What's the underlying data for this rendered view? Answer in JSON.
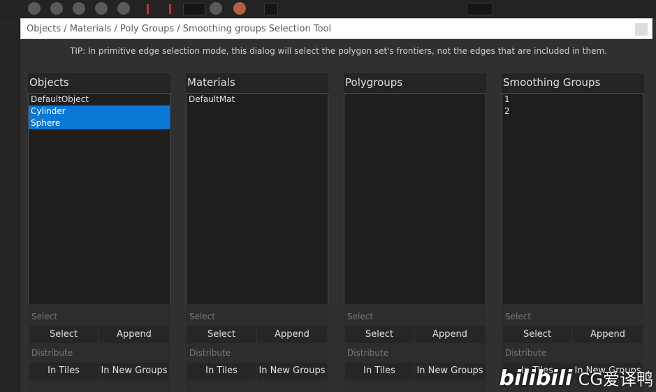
{
  "dialog": {
    "breadcrumb": "Objects / Materials / Poly Groups / Smoothing groups Selection Tool",
    "tip": "TIP: In primitive edge selection mode, this dialog will select the polygon set's frontiers, not the edges that are included in them."
  },
  "panels": [
    {
      "title": "Objects",
      "items": [
        {
          "label": "DefaultObject",
          "selected": false
        },
        {
          "label": "Cylinder",
          "selected": true
        },
        {
          "label": "Sphere",
          "selected": true
        }
      ],
      "select_label": "Select",
      "select_button": "Select",
      "append_button": "Append",
      "distribute_label": "Distribute",
      "in_tiles_button": "In Tiles",
      "in_new_groups_button": "In New Groups"
    },
    {
      "title": "Materials",
      "items": [
        {
          "label": "DefaultMat",
          "selected": false
        }
      ],
      "select_label": "Select",
      "select_button": "Select",
      "append_button": "Append",
      "distribute_label": "Distribute",
      "in_tiles_button": "In Tiles",
      "in_new_groups_button": "In New Groups"
    },
    {
      "title": "Polygroups",
      "items": [],
      "select_label": "Select",
      "select_button": "Select",
      "append_button": "Append",
      "distribute_label": "Distribute",
      "in_tiles_button": "In Tiles",
      "in_new_groups_button": "In New Groups"
    },
    {
      "title": "Smoothing Groups",
      "items": [
        {
          "label": "1",
          "selected": false
        },
        {
          "label": "2",
          "selected": false
        }
      ],
      "select_label": "Select",
      "select_button": "Select",
      "append_button": "Append",
      "distribute_label": "Distribute",
      "in_tiles_button": "In Tiles",
      "in_new_groups_button": "In New Groups"
    }
  ],
  "watermark": {
    "logo": "bilibili",
    "text": "CG爱译鸭"
  },
  "colors": {
    "selection": "#0a78d7",
    "panel_bg": "#242424",
    "dialog_bg": "#303030"
  }
}
